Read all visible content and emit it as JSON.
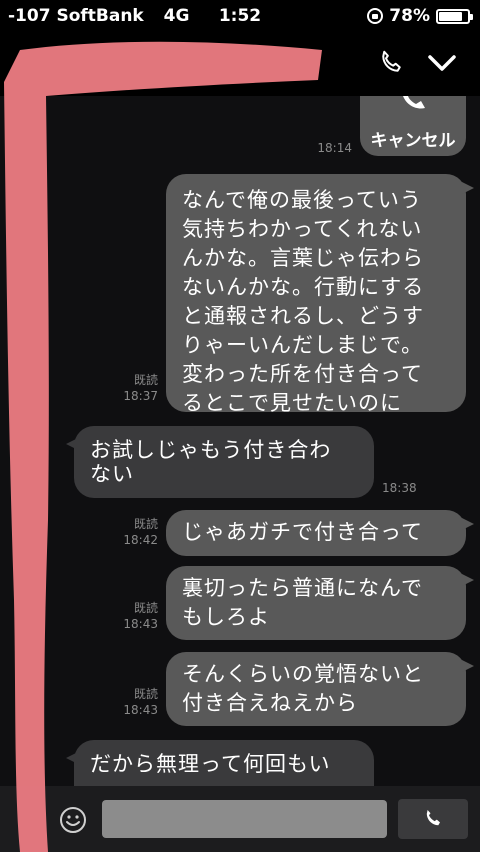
{
  "status": {
    "carrier": "-107 SoftBank",
    "network": "4G",
    "time": "1:52",
    "battery": "78%",
    "battery_level": 0.78
  },
  "header": {
    "icons": [
      "phone-icon",
      "chevron-down-icon"
    ]
  },
  "messages": {
    "cancel": {
      "label": "キャンセル",
      "time": "18:14"
    },
    "m1": {
      "lines": [
        "なんで俺の最後っていう",
        "気持ちわかってくれない",
        "んかな。言葉じゃ伝わら",
        "ないんかな。行動にする",
        "と通報されるし、どうす",
        "りゃーいんだしまじで。",
        "変わった所を付き合って",
        "るとこで見せたいのに"
      ],
      "read": "既読",
      "time": "18:37"
    },
    "m2": {
      "lines": [
        "お試しじゃもう付き合わ",
        "ない"
      ],
      "time": "18:38"
    },
    "m3": {
      "lines": [
        "じゃあガチで付き合って"
      ],
      "read": "既読",
      "time": "18:42"
    },
    "m4": {
      "lines": [
        "裏切ったら普通になんで",
        "もしろよ"
      ],
      "read": "既読",
      "time": "18:43"
    },
    "m5": {
      "lines": [
        "そんくらいの覚悟ないと",
        "付き合えねえから"
      ],
      "read": "既読",
      "time": "18:43"
    },
    "m6": {
      "lines": [
        "だから無理って何回もい"
      ]
    }
  },
  "input": {
    "value": "",
    "icons": [
      "smile-icon",
      "phone-icon"
    ]
  },
  "colors": {
    "outgoing_bubble": "#595959",
    "incoming_bubble": "#3a3a3c",
    "redaction": "#e87a80"
  }
}
